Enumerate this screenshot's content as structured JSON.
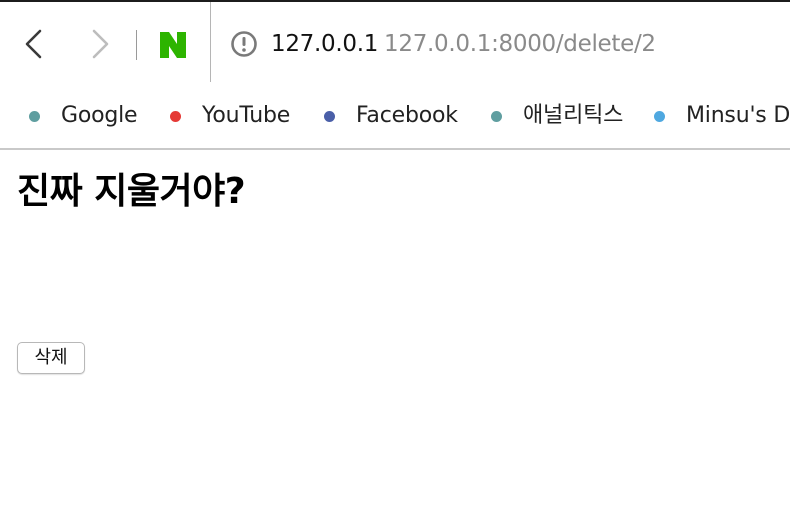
{
  "browser": {
    "address": {
      "host": "127.0.0.1",
      "full_url": "127.0.0.1:8000/delete/2"
    },
    "icons": {
      "back": "chevron-left-icon",
      "forward": "chevron-right-icon",
      "site": "naver-n-icon",
      "info": "info-circle-icon"
    },
    "colors": {
      "naver_green": "#2db400",
      "disabled_gray": "#bdbdbd",
      "url_gray": "#8a8a8a"
    }
  },
  "bookmarks": [
    {
      "label": "Google",
      "dot_color": "#5f9ea0"
    },
    {
      "label": "YouTube",
      "dot_color": "#e53935"
    },
    {
      "label": "Facebook",
      "dot_color": "#4a5fa8"
    },
    {
      "label": "애널리틱스",
      "dot_color": "#5f9ea0"
    },
    {
      "label": "Minsu's D",
      "dot_color": "#4fa8e0"
    }
  ],
  "content": {
    "heading": "진짜 지울거야?",
    "delete_button_label": "삭제"
  }
}
